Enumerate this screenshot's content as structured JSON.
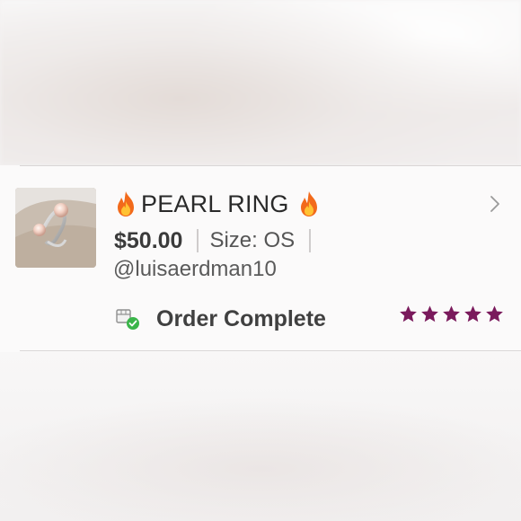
{
  "listing": {
    "title": "PEARL RING",
    "title_decoration_icon": "fire-icon",
    "price": "$50.00",
    "size": "Size: OS",
    "seller": "@luisaerdman10",
    "status": "Order Complete",
    "status_icon": "package-check-icon",
    "rating": 5,
    "rating_max": 5,
    "star_color": "#7a1a5c",
    "status_check_color": "#3bb54a"
  }
}
